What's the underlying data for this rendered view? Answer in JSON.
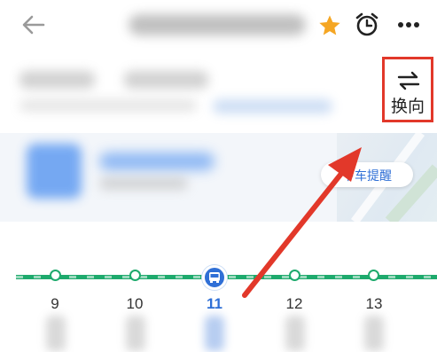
{
  "header": {
    "back_icon": "back-arrow-icon",
    "favorite_icon": "star-icon",
    "alarm_icon": "alarm-clock-icon",
    "more_icon": "more-dots-icon",
    "favorite_color": "#f5a623"
  },
  "direction_switch": {
    "label": "换向",
    "icon": "swap-arrows-icon",
    "highlight_color": "#e2382a"
  },
  "bus_card": {
    "remind_label": "下车提醒"
  },
  "route": {
    "line_color": "#1eaa6d",
    "current_color": "#2f6fd6",
    "stops": [
      "9",
      "10",
      "11",
      "12",
      "13"
    ],
    "current_stop": "11"
  }
}
